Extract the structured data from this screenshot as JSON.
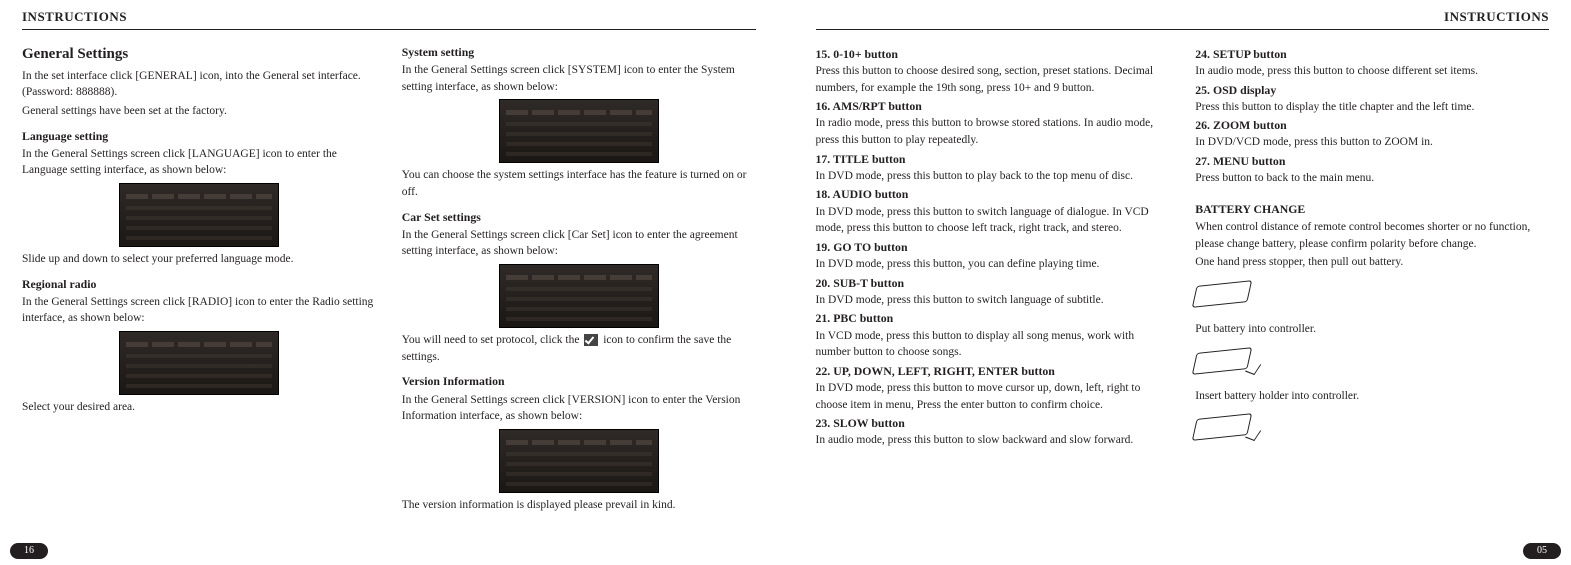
{
  "left": {
    "running_head": "INSTRUCTIONS",
    "page_number": "16",
    "col1": {
      "title": "General Settings",
      "intro1": "In the set interface click [GENERAL] icon, into the General set interface. (Password: 888888).",
      "intro2": "General settings have been set at the factory.",
      "lang_head": "Language setting",
      "lang_text": "In the General Settings screen click [LANGUAGE] icon to enter the Language setting interface, as shown below:",
      "lang_after": "Slide up and down to select your preferred language mode.",
      "radio_head": "Regional radio",
      "radio_text": "In the General Settings screen click [RADIO] icon to enter the Radio setting interface, as shown below:",
      "radio_after": "Select your desired area."
    },
    "col2": {
      "sys_head": "System setting",
      "sys_text": "In the General Settings screen click [SYSTEM] icon to enter the System setting interface, as shown below:",
      "sys_after": "You can choose the system settings interface has the feature is turned on or off.",
      "car_head": "Car Set settings",
      "car_text": "In the General Settings screen click [Car Set] icon to enter the agreement setting interface, as shown below:",
      "car_after_pre": "You will need to set protocol, click the ",
      "car_after_post": " icon to confirm the save the settings.",
      "ver_head": "Version Information",
      "ver_text": "In the General Settings screen click [VERSION] icon to enter the Version Information interface, as shown below:",
      "ver_after": "The version information is displayed please prevail in kind."
    }
  },
  "right": {
    "running_head": "INSTRUCTIONS",
    "page_number": "05",
    "col1": {
      "b15_h": "15. 0-10+ button",
      "b15_t": "Press this button to choose desired song,  section, preset stations. Decimal numbers, for example the 19th song,  press 10+ and 9 button.",
      "b16_h": "16. AMS/RPT button",
      "b16_t": "In radio mode, press this button to browse stored stations. In audio mode, press this button to play repeatedly.",
      "b17_h": "17. TITLE button",
      "b17_t": "In DVD mode, press this button to play back to the top menu of disc.",
      "b18_h": "18. AUDIO button",
      "b18_t": "In DVD mode, press this button to switch language of dialogue. In VCD mode, press  this button to choose left track, right track, and stereo.",
      "b19_h": "19. GO TO button",
      "b19_t": "In DVD mode, press this button, you can define playing time.",
      "b20_h": "20. SUB-T button",
      "b20_t": "In DVD mode, press this button to switch language of subtitle.",
      "b21_h": "21. PBC button",
      "b21_t": "In VCD mode, press this button to display all  song menus, work with number button to choose songs.",
      "b22_h": "22. UP, DOWN, LEFT, RIGHT, ENTER button",
      "b22_t": "In DVD mode, press this button to move cursor  up, down, left, right to choose item in menu, Press the enter button to confirm choice.",
      "b23_h": "23. SLOW button",
      "b23_t": "In audio mode, press this button to slow backward and slow forward."
    },
    "col2": {
      "b24_h": "24. SETUP button",
      "b24_t": "In audio mode, press this button to choose different set items.",
      "b25_h": "25. OSD display",
      "b25_t": "Press this button to display the title chapter and  the left time.",
      "b26_h": "26. ZOOM button",
      "b26_t": "In DVD/VCD mode, press this button to ZOOM in.",
      "b27_h": "27. MENU button",
      "b27_t": "Press button to back to the main menu.",
      "batt_h": "BATTERY CHANGE",
      "batt_t1": "When control distance of remote control becomes shorter or no function, please change  battery, please confirm polarity before change.",
      "batt_t2": "One hand press stopper, then pull out battery.",
      "batt_t3": "Put battery into controller.",
      "batt_t4": "Insert battery holder into controller."
    }
  }
}
